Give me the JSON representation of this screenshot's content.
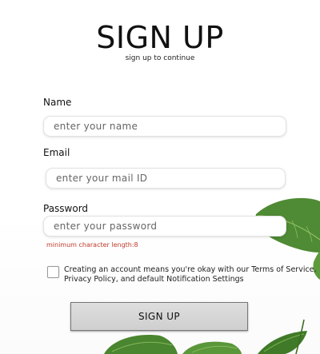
{
  "header": {
    "title": "SIGN UP",
    "subtitle": "sign up to continue"
  },
  "form": {
    "name": {
      "label": "Name",
      "placeholder": "enter your name",
      "value": ""
    },
    "email": {
      "label": "Email",
      "placeholder": "enter your mail ID",
      "value": ""
    },
    "password": {
      "label": "Password",
      "placeholder": "enter your password",
      "value": "",
      "hint": "minimum character length:8"
    },
    "terms": {
      "checked": false,
      "text": "Creating an account means you're okay with our Terms of Service, Privacy Policy, and default Notification Settings"
    },
    "submit_label": "SIGN UP"
  },
  "colors": {
    "error": "#c0392b",
    "leaf": "#4f8a34",
    "leaf_light": "#7fb24f",
    "button_bg": "#d6d6d6"
  },
  "decor": {
    "image": "leaf-plant"
  }
}
